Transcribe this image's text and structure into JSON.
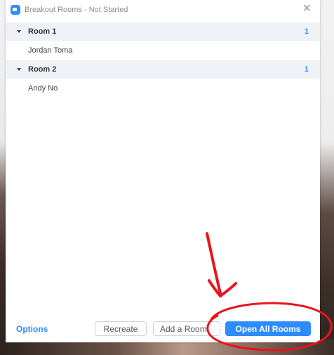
{
  "window": {
    "title": "Breakout Rooms - Not Started",
    "close_glyph": "✕"
  },
  "rooms": [
    {
      "name": "Room 1",
      "count": "1",
      "members": [
        "Jordan Toma"
      ]
    },
    {
      "name": "Room 2",
      "count": "1",
      "members": [
        "Andy No"
      ]
    }
  ],
  "footer": {
    "options_label": "Options",
    "recreate_label": "Recreate",
    "add_room_label": "Add a Room",
    "open_all_label": "Open All Rooms"
  },
  "annotation": {
    "color": "#e8141c",
    "shapes": [
      "arrow",
      "ellipse"
    ]
  },
  "colors": {
    "accent": "#2d8cff",
    "header_bg": "#eef1f5"
  },
  "icons": [
    "zoom-app-icon",
    "close-icon",
    "chevron-down-icon"
  ]
}
